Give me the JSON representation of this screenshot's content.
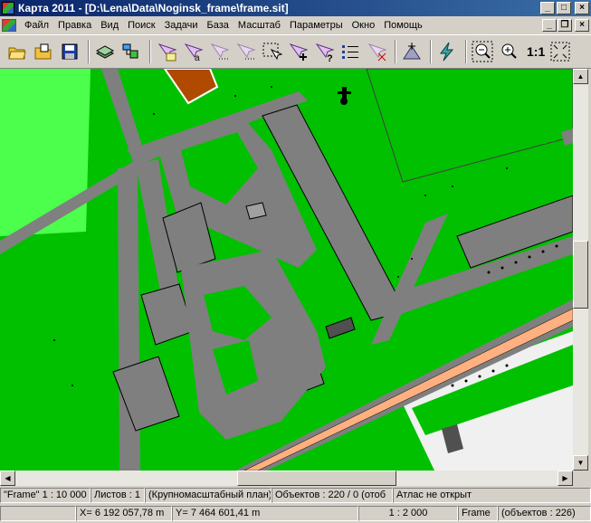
{
  "window": {
    "title": "Карта 2011 - [D:\\Lena\\Data\\Noginsk_frame\\frame.sit]",
    "minimize_glyph": "_",
    "maximize_glyph": "□",
    "close_glyph": "×",
    "mdi_restore_glyph": "❐"
  },
  "menu": {
    "items": [
      "Файл",
      "Правка",
      "Вид",
      "Поиск",
      "Задачи",
      "База",
      "Масштаб",
      "Параметры",
      "Окно",
      "Помощь"
    ]
  },
  "toolbar": {
    "scale_label": "1:1",
    "icons": [
      "open-folder-icon",
      "open-project-icon",
      "save-icon",
      "layers-icon",
      "legend-icon",
      "select-object-icon",
      "select-text-icon",
      "select-dotted-icon",
      "select-dotted-alt-icon",
      "select-frame-icon",
      "add-select-icon",
      "query-select-icon",
      "list-icon",
      "clear-select-icon",
      "move-icon",
      "lightning-icon",
      "zoom-out-icon",
      "zoom-in-icon",
      "fit-window-icon"
    ]
  },
  "statusbar": {
    "frame_info": "\"Frame\"  1 : 10 000",
    "sheets": "Листов : 1",
    "plan_type": "(Крупномасштабный план)",
    "objects": "Объектов : 220 / 0 (отоб",
    "atlas": "Атлас не открыт",
    "x_coord": "X= 6 192 057,78 m",
    "y_coord": "Y= 7 464 601,41 m",
    "scale": "1 : 2 000",
    "layer": "Frame",
    "layer_objects": "(объектов : 226)"
  },
  "colors": {
    "map_green": "#00c000",
    "light_green": "#4cff4c",
    "road_gray": "#7f7f7f",
    "building_brown": "#b04a00",
    "rail_orange": "#ffb080"
  }
}
